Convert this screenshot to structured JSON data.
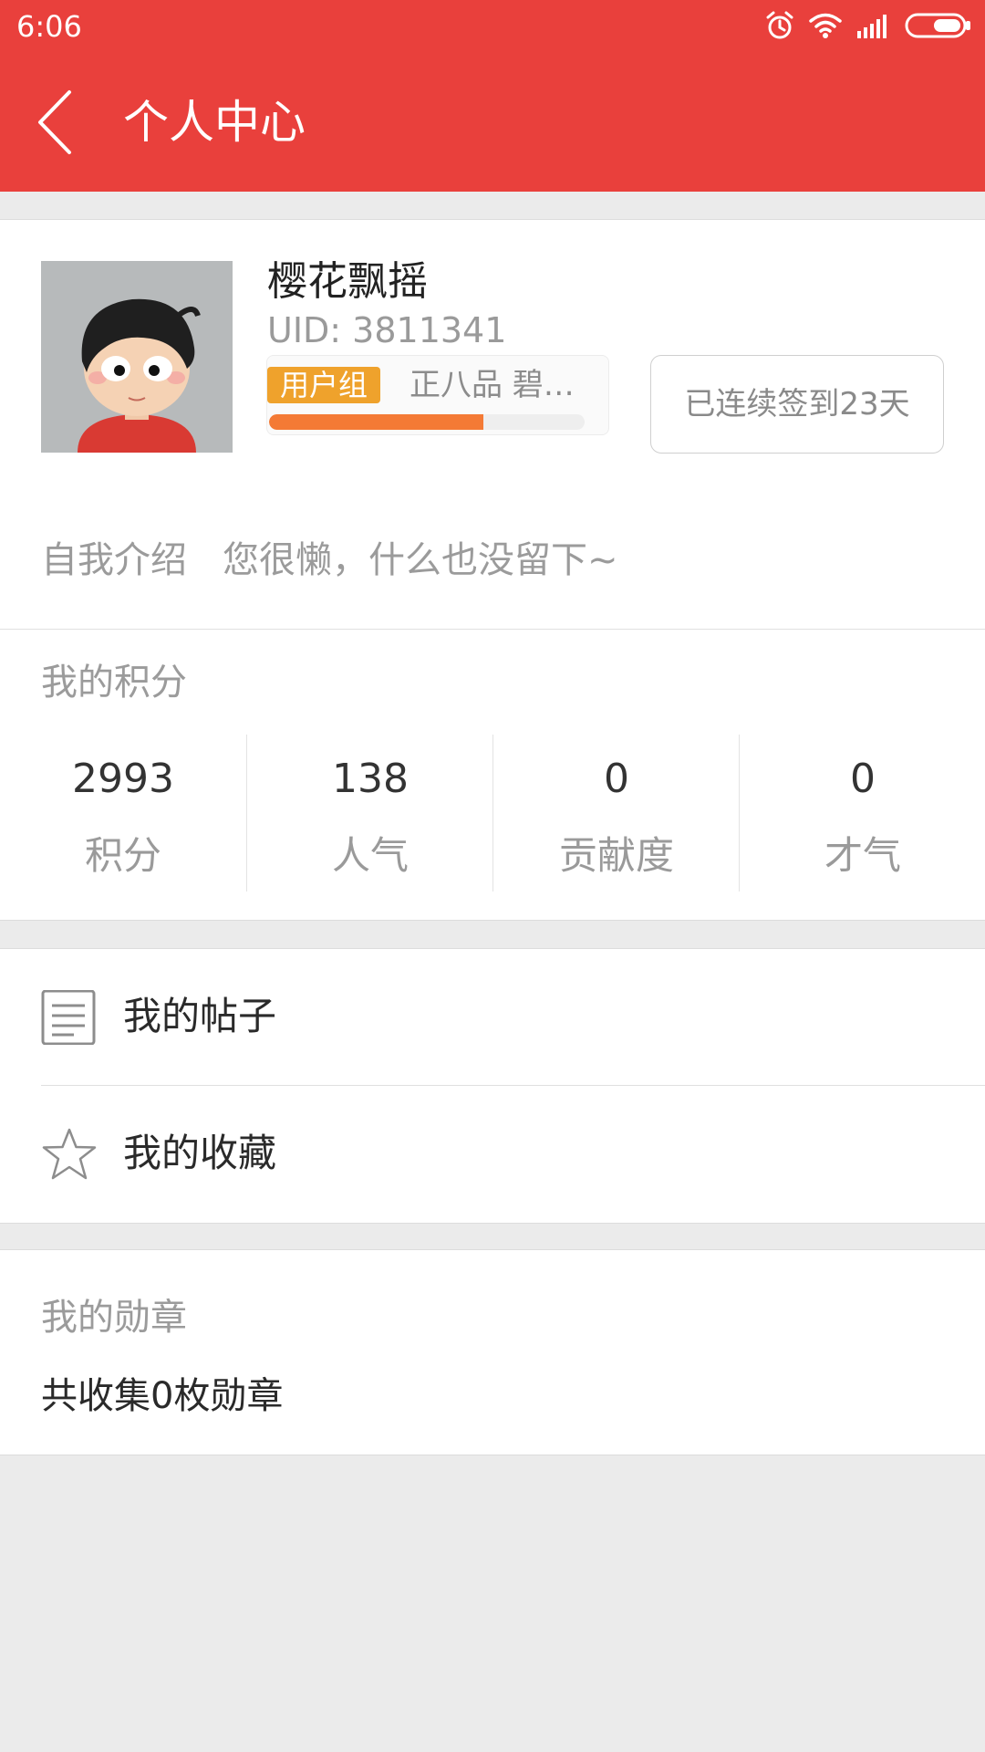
{
  "status": {
    "time": "6:06",
    "icons": [
      "alarm-icon",
      "wifi-icon",
      "signal-icon",
      "battery-icon"
    ]
  },
  "header": {
    "title": "个人中心",
    "background": "#e9403c"
  },
  "profile": {
    "username": "樱花飘摇",
    "uid": "UID: 3811341",
    "group_badge": "用户组",
    "group_text": "正八品 碧…",
    "progress_fraction": 0.68,
    "signin_text": "已连续签到23天",
    "badge_color": "#efa22c",
    "progress_color": "#f47a35"
  },
  "intro": {
    "label": "自我介绍",
    "text": "您很懒，什么也没留下~"
  },
  "scores": {
    "heading": "我的积分",
    "items": [
      {
        "value": "2993",
        "label": "积分"
      },
      {
        "value": "138",
        "label": "人气"
      },
      {
        "value": "0",
        "label": "贡献度"
      },
      {
        "value": "0",
        "label": "才气"
      }
    ]
  },
  "menu": {
    "items": [
      {
        "label": "我的帖子",
        "icon": "document-icon"
      },
      {
        "label": "我的收藏",
        "icon": "star-icon"
      }
    ]
  },
  "medals": {
    "heading": "我的勋章",
    "count_text": "共收集0枚勋章"
  }
}
